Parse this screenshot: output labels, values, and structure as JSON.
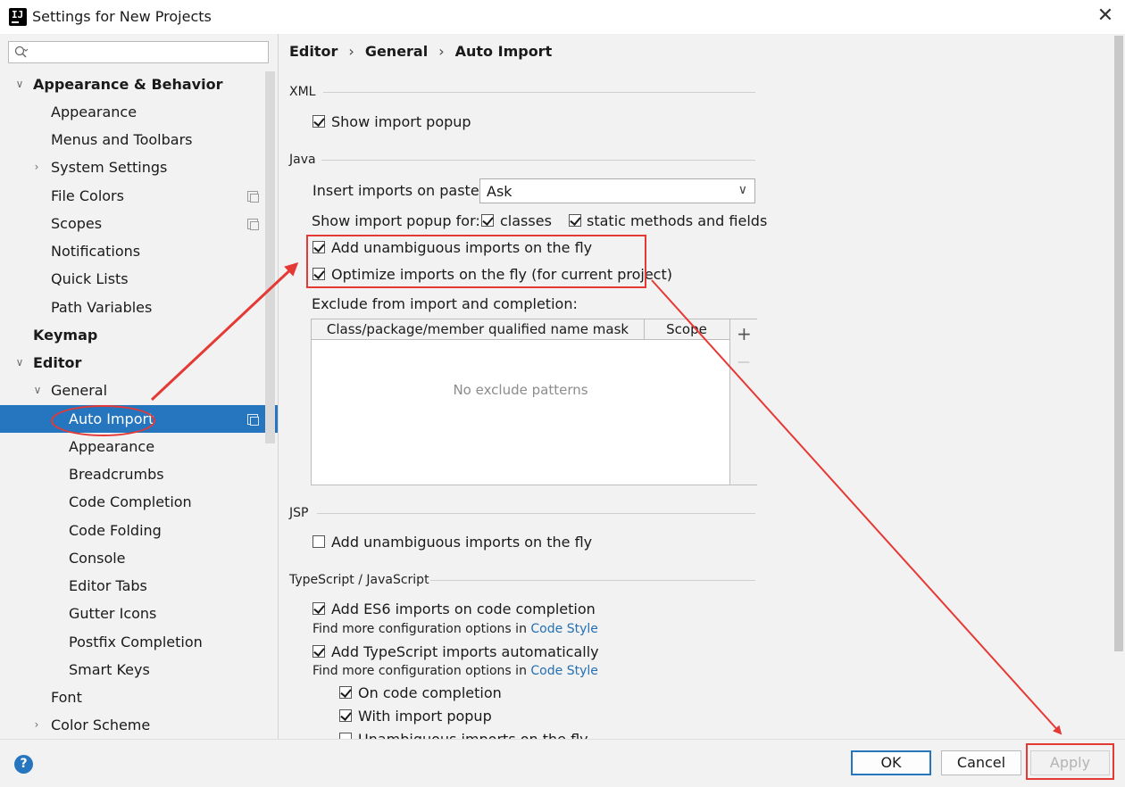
{
  "window": {
    "title": "Settings for New Projects",
    "close_glyph": "✕",
    "icon_text": "IJ"
  },
  "search": {
    "placeholder": ""
  },
  "tree": {
    "items": [
      {
        "label": "Appearance & Behavior",
        "expanded": true,
        "bold": true
      },
      {
        "label": "Appearance"
      },
      {
        "label": "Menus and Toolbars"
      },
      {
        "label": "System Settings",
        "collapsed": true
      },
      {
        "label": "File Colors"
      },
      {
        "label": "Scopes"
      },
      {
        "label": "Notifications"
      },
      {
        "label": "Quick Lists"
      },
      {
        "label": "Path Variables"
      },
      {
        "label": "Keymap",
        "bold": true
      },
      {
        "label": "Editor",
        "expanded": true,
        "bold": true
      },
      {
        "label": "General",
        "expanded": true
      },
      {
        "label": "Auto Import",
        "selected": true
      },
      {
        "label": "Appearance"
      },
      {
        "label": "Breadcrumbs"
      },
      {
        "label": "Code Completion"
      },
      {
        "label": "Code Folding"
      },
      {
        "label": "Console"
      },
      {
        "label": "Editor Tabs"
      },
      {
        "label": "Gutter Icons"
      },
      {
        "label": "Postfix Completion"
      },
      {
        "label": "Smart Keys"
      },
      {
        "label": "Font"
      },
      {
        "label": "Color Scheme",
        "collapsed": true
      }
    ]
  },
  "breadcrumb": {
    "part1": "Editor",
    "part2": "General",
    "part3": "Auto Import",
    "sep": "›"
  },
  "xml": {
    "section": "XML",
    "show_import_popup": "Show import popup"
  },
  "java": {
    "section": "Java",
    "insert_imports_label": "Insert imports on paste:",
    "insert_imports_value": "Ask",
    "show_popup_for": "Show import popup for:",
    "classes": "classes",
    "static_methods": "static methods and fields",
    "add_unambiguous": "Add unambiguous imports on the fly",
    "optimize_imports": "Optimize imports on the fly (for current project)",
    "exclude_label": "Exclude from import and completion:",
    "col_mask": "Class/package/member qualified name mask",
    "col_scope": "Scope",
    "empty_text": "No exclude patterns",
    "add_glyph": "+",
    "remove_glyph": "—"
  },
  "jsp": {
    "section": "JSP",
    "add_unambiguous": "Add unambiguous imports on the fly"
  },
  "ts": {
    "section": "TypeScript / JavaScript",
    "add_es6": "Add ES6 imports on code completion",
    "find_more_1": "Find more configuration options in",
    "code_style_1": "Code Style",
    "add_ts": "Add TypeScript imports automatically",
    "find_more_2": "Find more configuration options in",
    "code_style_2": "Code Style",
    "on_completion": "On code completion",
    "with_popup": "With import popup",
    "unambiguous": "Unambiguous imports on the fly"
  },
  "buttons": {
    "ok": "OK",
    "cancel": "Cancel",
    "apply": "Apply",
    "help": "?"
  },
  "colors": {
    "selection": "#2675bf",
    "annotation": "#e53935",
    "link": "#2470b3"
  },
  "icons": [
    "app-icon",
    "close-icon",
    "search-icon",
    "chevron-down-icon",
    "chevron-right-icon",
    "project-settings-icon",
    "plus-icon",
    "minus-icon",
    "help-icon"
  ]
}
